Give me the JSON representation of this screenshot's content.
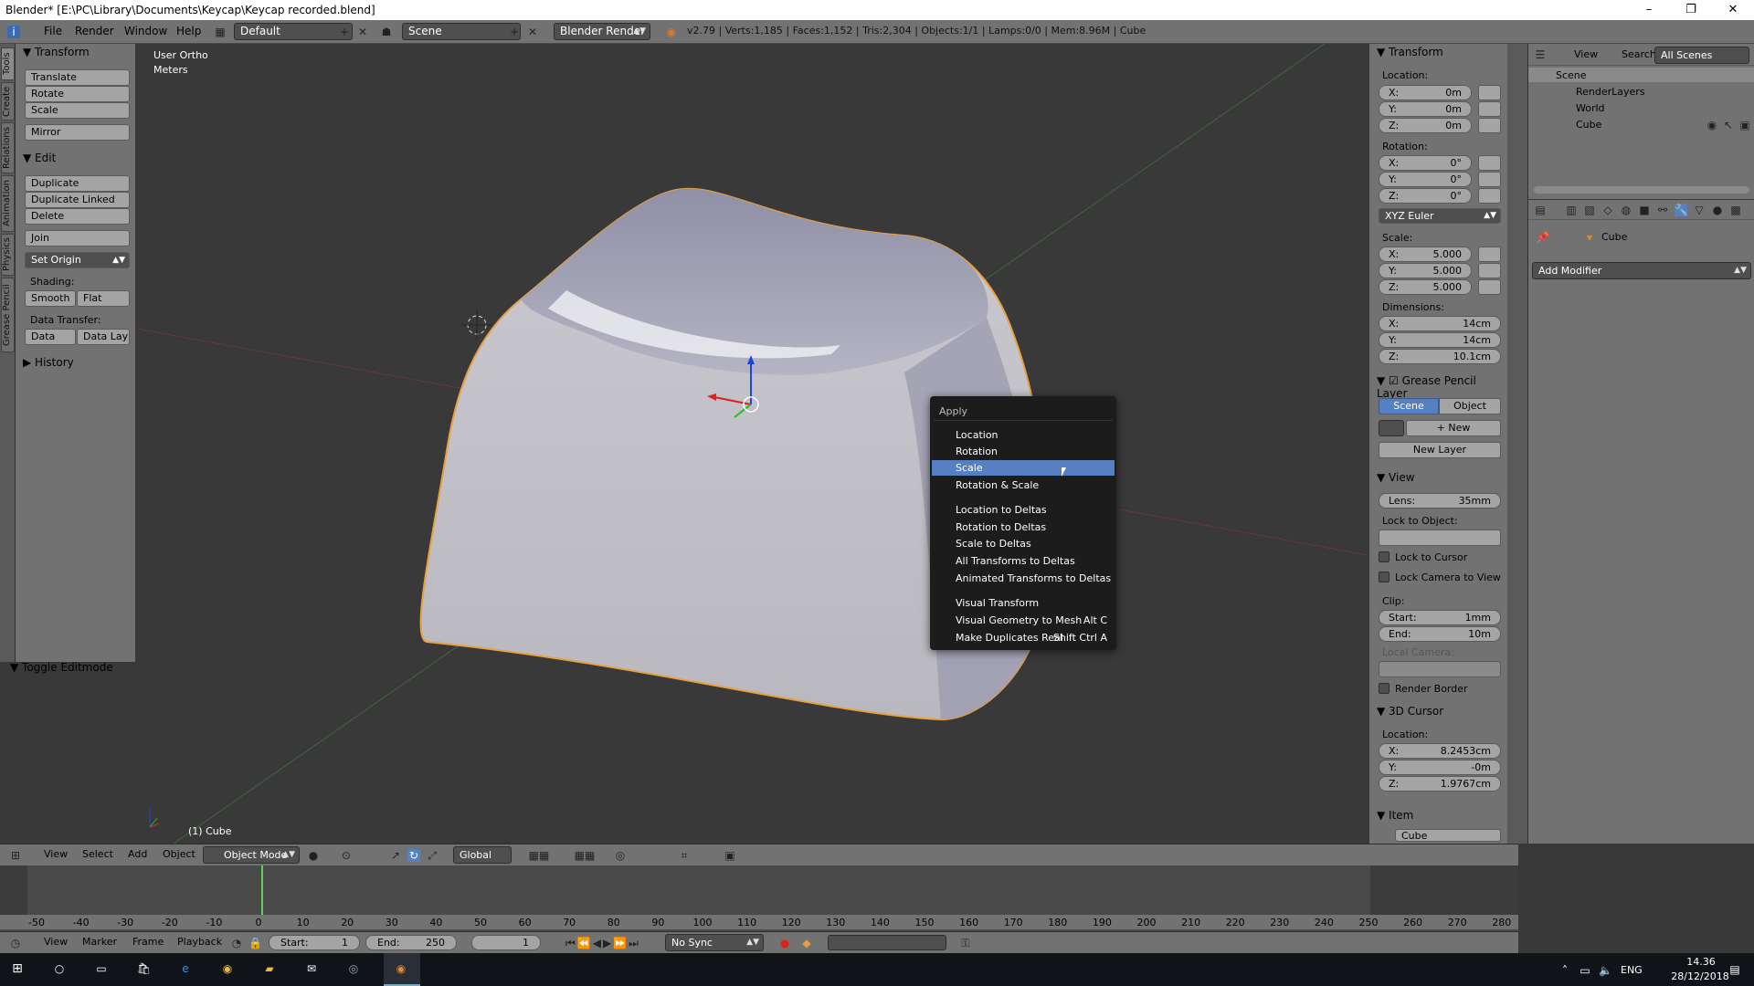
{
  "window": {
    "title": "Blender* [E:\\PC\\Library\\Documents\\Keycap\\Keycap recorded.blend]",
    "controls": [
      "–",
      "❐",
      "✕"
    ]
  },
  "info_header": {
    "menus": [
      "File",
      "Render",
      "Window",
      "Help"
    ],
    "layout": "Default",
    "scene": "Scene",
    "engine": "Blender Render",
    "stats": "v2.79 | Verts:1,185 | Faces:1,152 | Tris:2,304 | Objects:1/1 | Lamps:0/0 | Mem:8.96M | Cube"
  },
  "tool_tabs": [
    "Tools",
    "Create",
    "Relations",
    "Animation",
    "Physics",
    "Grease Pencil"
  ],
  "toolshelf": {
    "transform_header": "Transform",
    "translate": "Translate",
    "rotate": "Rotate",
    "scale": "Scale",
    "mirror": "Mirror",
    "edit_header": "Edit",
    "duplicate": "Duplicate",
    "duplicate_linked": "Duplicate Linked",
    "delete": "Delete",
    "join": "Join",
    "set_origin": "Set Origin",
    "shading_label": "Shading:",
    "smooth": "Smooth",
    "flat": "Flat",
    "data_transfer_label": "Data Transfer:",
    "data": "Data",
    "data_lay": "Data Lay",
    "history_header": "History",
    "toggle_editmode": "Toggle Editmode"
  },
  "viewport": {
    "view_name": "User Ortho",
    "units": "Meters",
    "object_label": "(1) Cube"
  },
  "context_menu": {
    "title": "Apply",
    "items": [
      {
        "label": "Location"
      },
      {
        "label": "Rotation"
      },
      {
        "label": "Scale",
        "selected": true
      },
      {
        "label": "Rotation & Scale"
      },
      {
        "label": "Location to Deltas"
      },
      {
        "label": "Rotation to Deltas"
      },
      {
        "label": "Scale to Deltas"
      },
      {
        "label": "All Transforms to Deltas"
      },
      {
        "label": "Animated Transforms to Deltas"
      },
      {
        "label": "Visual Transform"
      },
      {
        "label": "Visual Geometry to Mesh",
        "shortcut": "Alt C"
      },
      {
        "label": "Make Duplicates Real",
        "shortcut": "Shift Ctrl A"
      }
    ]
  },
  "npanel": {
    "transform_header": "Transform",
    "location_label": "Location:",
    "location": {
      "x": "0m",
      "y": "0m",
      "z": "0m"
    },
    "rotation_label": "Rotation:",
    "rotation": {
      "x": "0°",
      "y": "0°",
      "z": "0°"
    },
    "rotation_mode": "XYZ Euler",
    "scale_label": "Scale:",
    "scale": {
      "x": "5.000",
      "y": "5.000",
      "z": "5.000"
    },
    "dimensions_label": "Dimensions:",
    "dimensions": {
      "x": "14cm",
      "y": "14cm",
      "z": "10.1cm"
    },
    "grease_header": "Grease Pencil Layer",
    "scene_tab": "Scene",
    "object_tab": "Object",
    "new_btn": "New",
    "new_layer_btn": "New Layer",
    "view_header": "View",
    "lens": "35mm",
    "lens_key": "Lens:",
    "lock_to_object": "Lock to Object:",
    "lock_to_cursor": "Lock to Cursor",
    "lock_camera": "Lock Camera to View",
    "clip_label": "Clip:",
    "clip_start_key": "Start:",
    "clip_start": "1mm",
    "clip_end_key": "End:",
    "clip_end": "10m",
    "local_camera": "Local Camera:",
    "render_border": "Render Border",
    "cursor_header": "3D Cursor",
    "cursor_location_label": "Location:",
    "cursor": {
      "x": "8.2453cm",
      "y": "-0m",
      "z": "1.9767cm"
    },
    "item_header": "Item",
    "item_name": "Cube",
    "axis_x": "X:",
    "axis_y": "Y:",
    "axis_z": "Z:"
  },
  "outliner": {
    "view": "View",
    "search": "Search",
    "filter": "All Scenes",
    "tree": [
      "Scene",
      "RenderLayers",
      "World",
      "Cube"
    ]
  },
  "properties": {
    "object_name": "Cube",
    "add_modifier": "Add Modifier"
  },
  "view3d_header": {
    "menus": [
      "View",
      "Select",
      "Add",
      "Object"
    ],
    "mode": "Object Mode",
    "orientation": "Global"
  },
  "timeline": {
    "ticks": [
      "-50",
      "-40",
      "-30",
      "-20",
      "-10",
      "0",
      "10",
      "20",
      "30",
      "40",
      "50",
      "60",
      "70",
      "80",
      "90",
      "100",
      "110",
      "120",
      "130",
      "140",
      "150",
      "160",
      "170",
      "180",
      "190",
      "200",
      "210",
      "220",
      "230",
      "240",
      "250",
      "260",
      "270",
      "280"
    ],
    "menus": [
      "View",
      "Marker",
      "Frame",
      "Playback"
    ],
    "start_label": "Start:",
    "start": "1",
    "end_label": "End:",
    "end": "250",
    "current": "1",
    "sync": "No Sync"
  },
  "taskbar": {
    "lang": "ENG",
    "time": "14.36",
    "date": "28/12/2018"
  },
  "colors": {
    "menu_highlight": "#5680c2",
    "panel_bg": "#727272",
    "viewport_bg": "#393939",
    "selection_outline": "#e8a040"
  }
}
